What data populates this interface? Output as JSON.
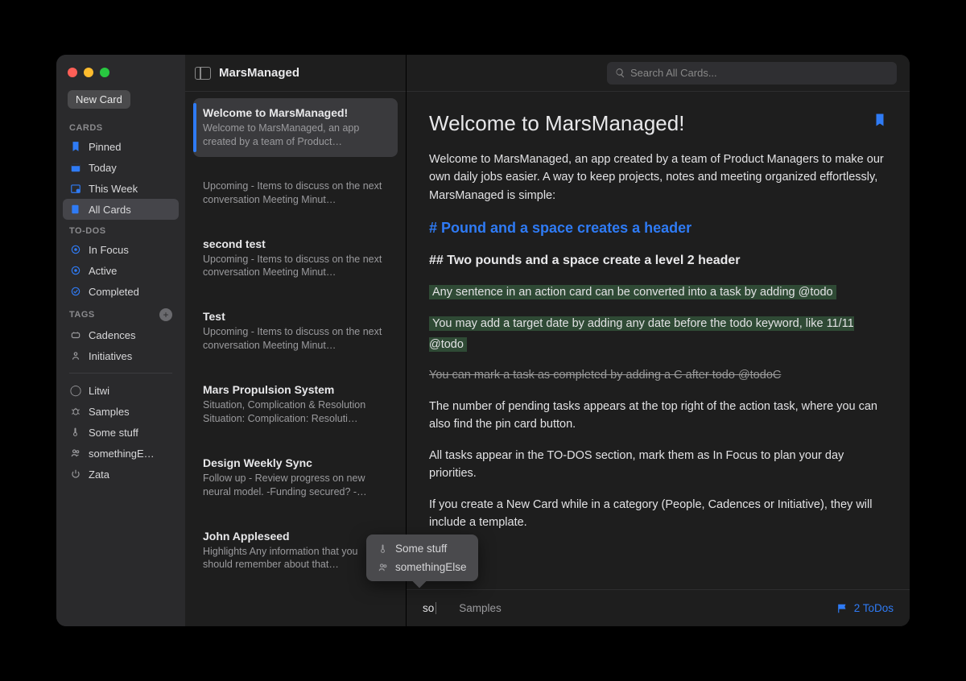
{
  "app_title": "MarsManaged",
  "new_card_label": "New Card",
  "search_placeholder": "Search All Cards...",
  "sections": {
    "cards_label": "CARDS",
    "todos_label": "TO-DOS",
    "tags_label": "TAGS"
  },
  "nav": {
    "cards": [
      {
        "label": "Pinned"
      },
      {
        "label": "Today"
      },
      {
        "label": "This Week"
      },
      {
        "label": "All Cards",
        "selected": true
      }
    ],
    "todos": [
      {
        "label": "In Focus"
      },
      {
        "label": "Active"
      },
      {
        "label": "Completed"
      }
    ],
    "tags": [
      {
        "label": "Cadences"
      },
      {
        "label": "Initiatives"
      }
    ],
    "extra_tags": [
      {
        "label": "Litwi"
      },
      {
        "label": "Samples"
      },
      {
        "label": "Some stuff"
      },
      {
        "label": "somethingE…"
      },
      {
        "label": "Zata"
      }
    ]
  },
  "cards": [
    {
      "title": "Welcome to MarsManaged!",
      "preview": "Welcome to MarsManaged, an app created by a team of Product…",
      "selected": true
    },
    {
      "title": "",
      "preview": "Upcoming - Items to discuss on the next conversation   Meeting Minut…"
    },
    {
      "title": "second test",
      "preview": "Upcoming - Items to discuss on the next conversation   Meeting Minut…"
    },
    {
      "title": "Test",
      "preview": "Upcoming - Items to discuss on the next conversation   Meeting Minut…"
    },
    {
      "title": "Mars Propulsion System",
      "preview": "Situation, Complication & Resolution Situation:  Complication:  Resoluti…"
    },
    {
      "title": "Design Weekly Sync",
      "preview": "Follow up - Review progress on new neural model.  -Funding secured? -…"
    },
    {
      "title": "John Appleseed",
      "preview": "Highlights Any information that you should remember about that…"
    }
  ],
  "detail": {
    "title": "Welcome to MarsManaged!",
    "intro": "Welcome to MarsManaged, an app created by a team of Product Managers to make our own daily jobs easier. A way to keep projects, notes and meeting organized effortlessly, MarsManaged is simple:",
    "h1": "# Pound and a space creates a header",
    "h2": "## Two pounds and a space create a level 2 header",
    "todo1": "Any sentence in an action card can be converted into a task by adding @todo",
    "todo2": "You may add a target date by adding any date before the todo keyword, like 11/11 @todo",
    "completed": "You can mark a task as completed by adding a C after todo @todoC",
    "p1": "The number of pending tasks appears at the top right of the action task, where you can also find the pin card button.",
    "p2": "All tasks appear in the TO-DOS section, mark them as In Focus to plan your day priorities.",
    "p3": "If you create a New Card while in a category (People, Cadences or Initiative), they will include a template."
  },
  "footer": {
    "input_value": "so",
    "tag": "Samples",
    "todo_count": "2 ToDos"
  },
  "popup": {
    "items": [
      {
        "label": "Some stuff"
      },
      {
        "label": "somethingElse"
      }
    ]
  }
}
